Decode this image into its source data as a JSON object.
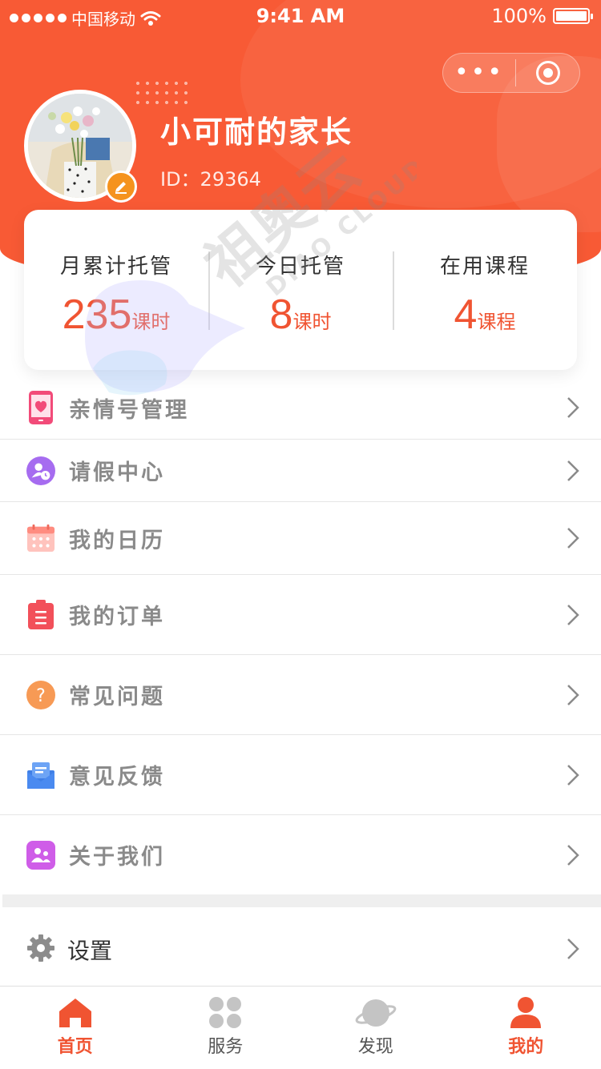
{
  "status_bar": {
    "carrier": "中国移动",
    "time": "9:41 AM",
    "battery": "100%"
  },
  "capsule": {
    "more": "•••"
  },
  "profile": {
    "name": "小可耐的家长",
    "id_label": "ID：29364"
  },
  "stats": [
    {
      "label": "月累计托管",
      "value": "235",
      "unit": "课时"
    },
    {
      "label": "今日托管",
      "value": "8",
      "unit": "课时"
    },
    {
      "label": "在用课程",
      "value": "4",
      "unit": "课程"
    }
  ],
  "menu": [
    {
      "label": "亲情号管理",
      "icon": "phone-heart-icon"
    },
    {
      "label": "请假中心",
      "icon": "leave-clock-icon"
    },
    {
      "label": "我的日历",
      "icon": "calendar-icon"
    },
    {
      "label": "我的订单",
      "icon": "order-clipboard-icon"
    },
    {
      "label": "常见问题",
      "icon": "question-icon"
    },
    {
      "label": "意见反馈",
      "icon": "feedback-mail-icon"
    },
    {
      "label": "关于我们",
      "icon": "about-people-icon"
    }
  ],
  "settings": {
    "label": "设置",
    "icon": "gear-icon"
  },
  "tabs": [
    {
      "label": "首页",
      "icon": "home-icon",
      "active": true
    },
    {
      "label": "服务",
      "icon": "grid-icon",
      "active": false
    },
    {
      "label": "发现",
      "icon": "planet-icon",
      "active": false
    },
    {
      "label": "我的",
      "icon": "person-icon",
      "active": true
    }
  ],
  "watermark": {
    "text_cn": "祖奥云",
    "text_en": "DIAO CLOUD"
  },
  "colors": {
    "accent": "#f85a35",
    "stat_number": "#f05432",
    "tab_active": "#f05432"
  }
}
